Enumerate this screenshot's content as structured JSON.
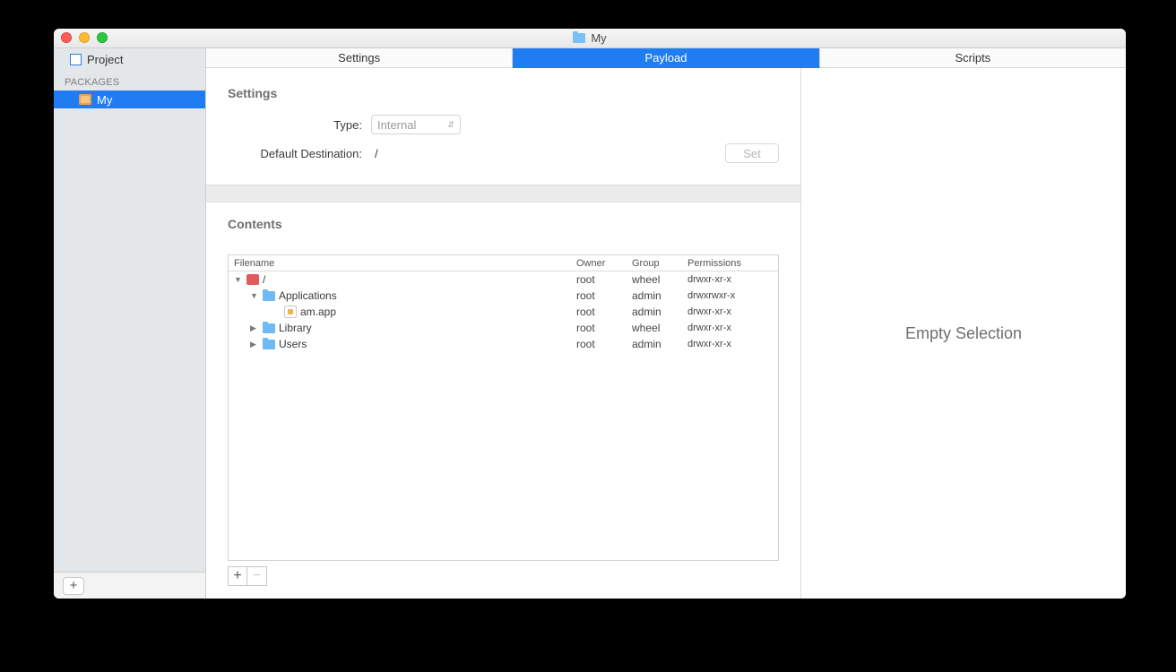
{
  "window": {
    "title": "My"
  },
  "sidebar": {
    "project_label": "Project",
    "section_label": "PACKAGES",
    "package_name": "My"
  },
  "tabs": {
    "settings": "Settings",
    "payload": "Payload",
    "scripts": "Scripts",
    "active": "payload"
  },
  "settings": {
    "heading": "Settings",
    "type_label": "Type:",
    "type_value": "Internal",
    "dest_label": "Default Destination:",
    "dest_value": "/",
    "set_button": "Set"
  },
  "contents": {
    "heading": "Contents",
    "columns": {
      "filename": "Filename",
      "owner": "Owner",
      "group": "Group",
      "permissions": "Permissions"
    },
    "rows": [
      {
        "indent": 0,
        "disclosure": "down",
        "icon": "root",
        "name": "/",
        "owner": "root",
        "group": "wheel",
        "perm": "drwxr-xr-x"
      },
      {
        "indent": 1,
        "disclosure": "down",
        "icon": "folder",
        "name": "Applications",
        "owner": "root",
        "group": "admin",
        "perm": "drwxrwxr-x"
      },
      {
        "indent": 2,
        "disclosure": "none",
        "icon": "app",
        "name": "am.app",
        "owner": "root",
        "group": "admin",
        "perm": "drwxr-xr-x"
      },
      {
        "indent": 1,
        "disclosure": "right",
        "icon": "folder",
        "name": "Library",
        "owner": "root",
        "group": "wheel",
        "perm": "drwxr-xr-x"
      },
      {
        "indent": 1,
        "disclosure": "right",
        "icon": "folder",
        "name": "Users",
        "owner": "root",
        "group": "admin",
        "perm": "drwxr-xr-x"
      }
    ]
  },
  "right_pane": {
    "empty_text": "Empty Selection"
  },
  "icons": {
    "plus": "+",
    "minus": "−",
    "chev_updown": "⌃⌄"
  }
}
